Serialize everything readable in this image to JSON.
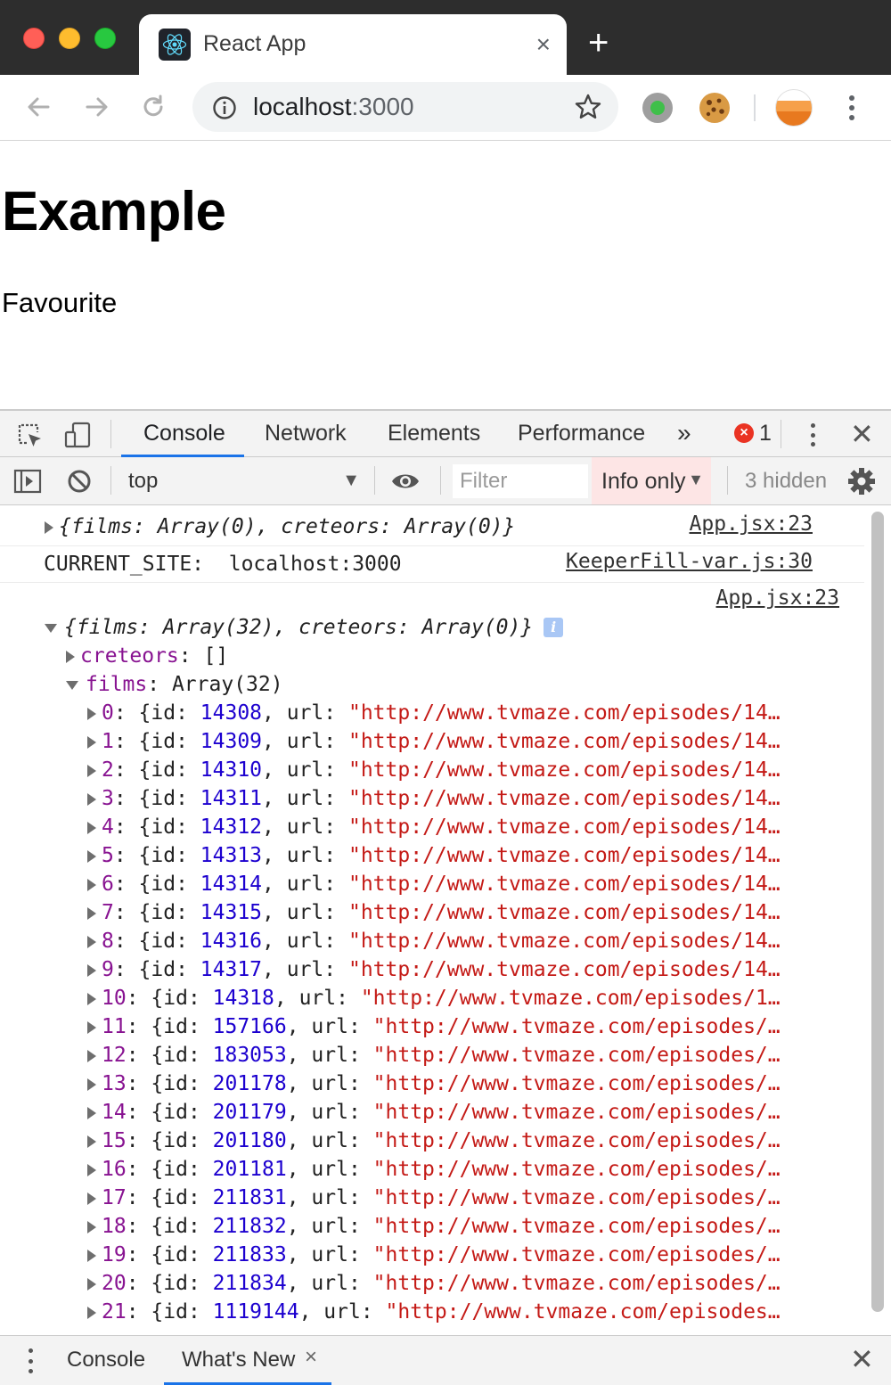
{
  "browser": {
    "tab_title": "React App",
    "tab_close_glyph": "×",
    "new_tab_glyph": "+",
    "url_host": "localhost",
    "url_port": ":3000",
    "icons": [
      "back-icon",
      "forward-icon",
      "reload-icon",
      "info-icon",
      "star-icon",
      "recorder-extension-icon",
      "cookie-extension-icon",
      "profile-avatar",
      "menu-icon"
    ]
  },
  "page": {
    "heading": "Example",
    "paragraph": "Favourite"
  },
  "devtools": {
    "tabs": [
      "Console",
      "Network",
      "Elements",
      "Performance"
    ],
    "active_tab": "Console",
    "more_tabs_glyph": "»",
    "error_count": "1",
    "close_glyph": "✕",
    "filter_bar": {
      "context": "top",
      "filter_placeholder": "Filter",
      "level": "Info only",
      "hidden": "3 hidden"
    },
    "console": {
      "messages": [
        {
          "text_open": "{",
          "text_body": "films: Array(0), creteors: Array(0)",
          "text_close": "}",
          "source": "App.jsx:23"
        },
        {
          "label": "CURRENT_SITE:",
          "value": "localhost:3000",
          "source": "KeeperFill-var.js:30"
        },
        {
          "source": "App.jsx:23",
          "summary": "films: Array(32), creteors: Array(0)",
          "info_glyph": "i"
        }
      ],
      "creteors": {
        "key": "creteors",
        "value": "[]"
      },
      "films": {
        "key": "films",
        "value": "Array(32)"
      },
      "entries": [
        {
          "i": "0",
          "id": "14308",
          "url": "\"http://www.tvmaze.com/episodes/14…"
        },
        {
          "i": "1",
          "id": "14309",
          "url": "\"http://www.tvmaze.com/episodes/14…"
        },
        {
          "i": "2",
          "id": "14310",
          "url": "\"http://www.tvmaze.com/episodes/14…"
        },
        {
          "i": "3",
          "id": "14311",
          "url": "\"http://www.tvmaze.com/episodes/14…"
        },
        {
          "i": "4",
          "id": "14312",
          "url": "\"http://www.tvmaze.com/episodes/14…"
        },
        {
          "i": "5",
          "id": "14313",
          "url": "\"http://www.tvmaze.com/episodes/14…"
        },
        {
          "i": "6",
          "id": "14314",
          "url": "\"http://www.tvmaze.com/episodes/14…"
        },
        {
          "i": "7",
          "id": "14315",
          "url": "\"http://www.tvmaze.com/episodes/14…"
        },
        {
          "i": "8",
          "id": "14316",
          "url": "\"http://www.tvmaze.com/episodes/14…"
        },
        {
          "i": "9",
          "id": "14317",
          "url": "\"http://www.tvmaze.com/episodes/14…"
        },
        {
          "i": "10",
          "id": "14318",
          "url": "\"http://www.tvmaze.com/episodes/1…"
        },
        {
          "i": "11",
          "id": "157166",
          "url": "\"http://www.tvmaze.com/episodes/…"
        },
        {
          "i": "12",
          "id": "183053",
          "url": "\"http://www.tvmaze.com/episodes/…"
        },
        {
          "i": "13",
          "id": "201178",
          "url": "\"http://www.tvmaze.com/episodes/…"
        },
        {
          "i": "14",
          "id": "201179",
          "url": "\"http://www.tvmaze.com/episodes/…"
        },
        {
          "i": "15",
          "id": "201180",
          "url": "\"http://www.tvmaze.com/episodes/…"
        },
        {
          "i": "16",
          "id": "201181",
          "url": "\"http://www.tvmaze.com/episodes/…"
        },
        {
          "i": "17",
          "id": "211831",
          "url": "\"http://www.tvmaze.com/episodes/…"
        },
        {
          "i": "18",
          "id": "211832",
          "url": "\"http://www.tvmaze.com/episodes/…"
        },
        {
          "i": "19",
          "id": "211833",
          "url": "\"http://www.tvmaze.com/episodes/…"
        },
        {
          "i": "20",
          "id": "211834",
          "url": "\"http://www.tvmaze.com/episodes/…"
        },
        {
          "i": "21",
          "id": "1119144",
          "url": "\"http://www.tvmaze.com/episodes…"
        }
      ]
    },
    "drawer": {
      "tabs": [
        "Console",
        "What's New"
      ],
      "active_tab": "What's New",
      "tab_close_glyph": "×",
      "close_glyph": "✕"
    }
  },
  "colors": {
    "accent": "#1a73e8",
    "property": "#881391",
    "number": "#1c00cf",
    "string": "#c41a16",
    "error_badge": "#ea3323",
    "level_select_bg": "#fde5e5"
  }
}
